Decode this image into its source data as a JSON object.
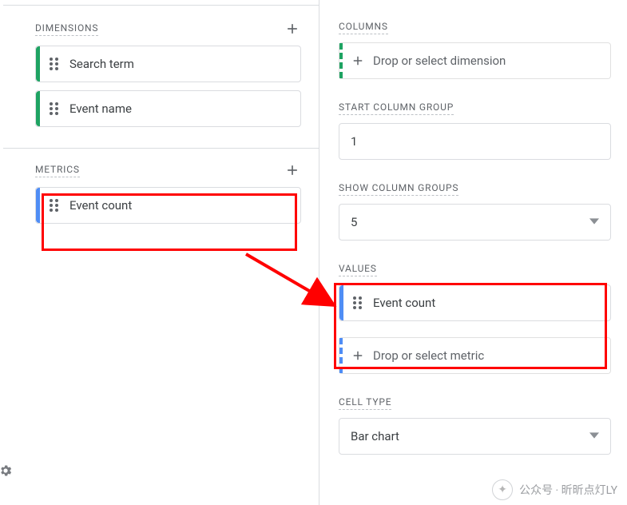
{
  "left": {
    "dimensions": {
      "title": "DIMENSIONS",
      "items": [
        "Search term",
        "Event name"
      ]
    },
    "metrics": {
      "title": "METRICS",
      "items": [
        "Event count"
      ]
    }
  },
  "right": {
    "columns": {
      "title": "COLUMNS",
      "dropzone": "Drop or select dimension"
    },
    "start_col_group": {
      "title": "START COLUMN GROUP",
      "value": "1"
    },
    "show_col_groups": {
      "title": "SHOW COLUMN GROUPS",
      "value": "5"
    },
    "values": {
      "title": "VALUES",
      "items": [
        "Event count"
      ],
      "dropzone": "Drop or select metric"
    },
    "cell_type": {
      "title": "CELL TYPE",
      "value": "Bar chart"
    }
  },
  "watermark": "公众号 · 昕昕点灯LY"
}
